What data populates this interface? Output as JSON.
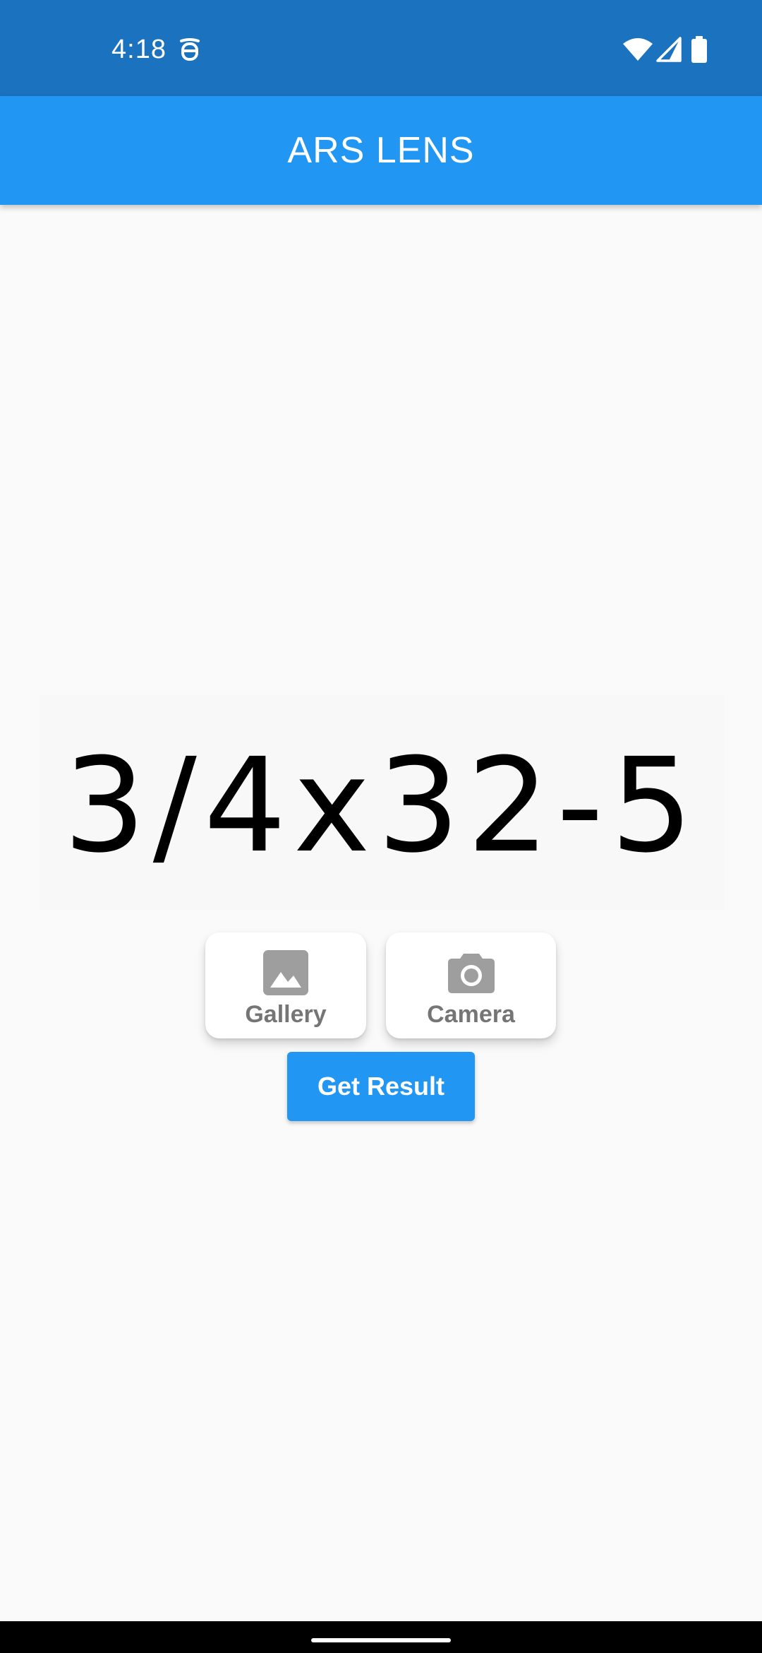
{
  "status_bar": {
    "time": "4:18",
    "icons": [
      "app-notification-icon",
      "wifi-icon",
      "cellular-signal-icon",
      "battery-icon"
    ]
  },
  "app_bar": {
    "title": "ARS LENS",
    "color": "#2196f3"
  },
  "preview": {
    "equation": "3/4x32-5"
  },
  "sources": {
    "gallery": {
      "label": "Gallery",
      "icon": "image-icon"
    },
    "camera": {
      "label": "Camera",
      "icon": "camera-icon"
    }
  },
  "actions": {
    "get_result_label": "Get Result",
    "color": "#2196f3"
  },
  "colors": {
    "status_bar": "#1b72bf",
    "accent": "#2196f3",
    "background": "#fafafa",
    "card_text": "#757575"
  }
}
